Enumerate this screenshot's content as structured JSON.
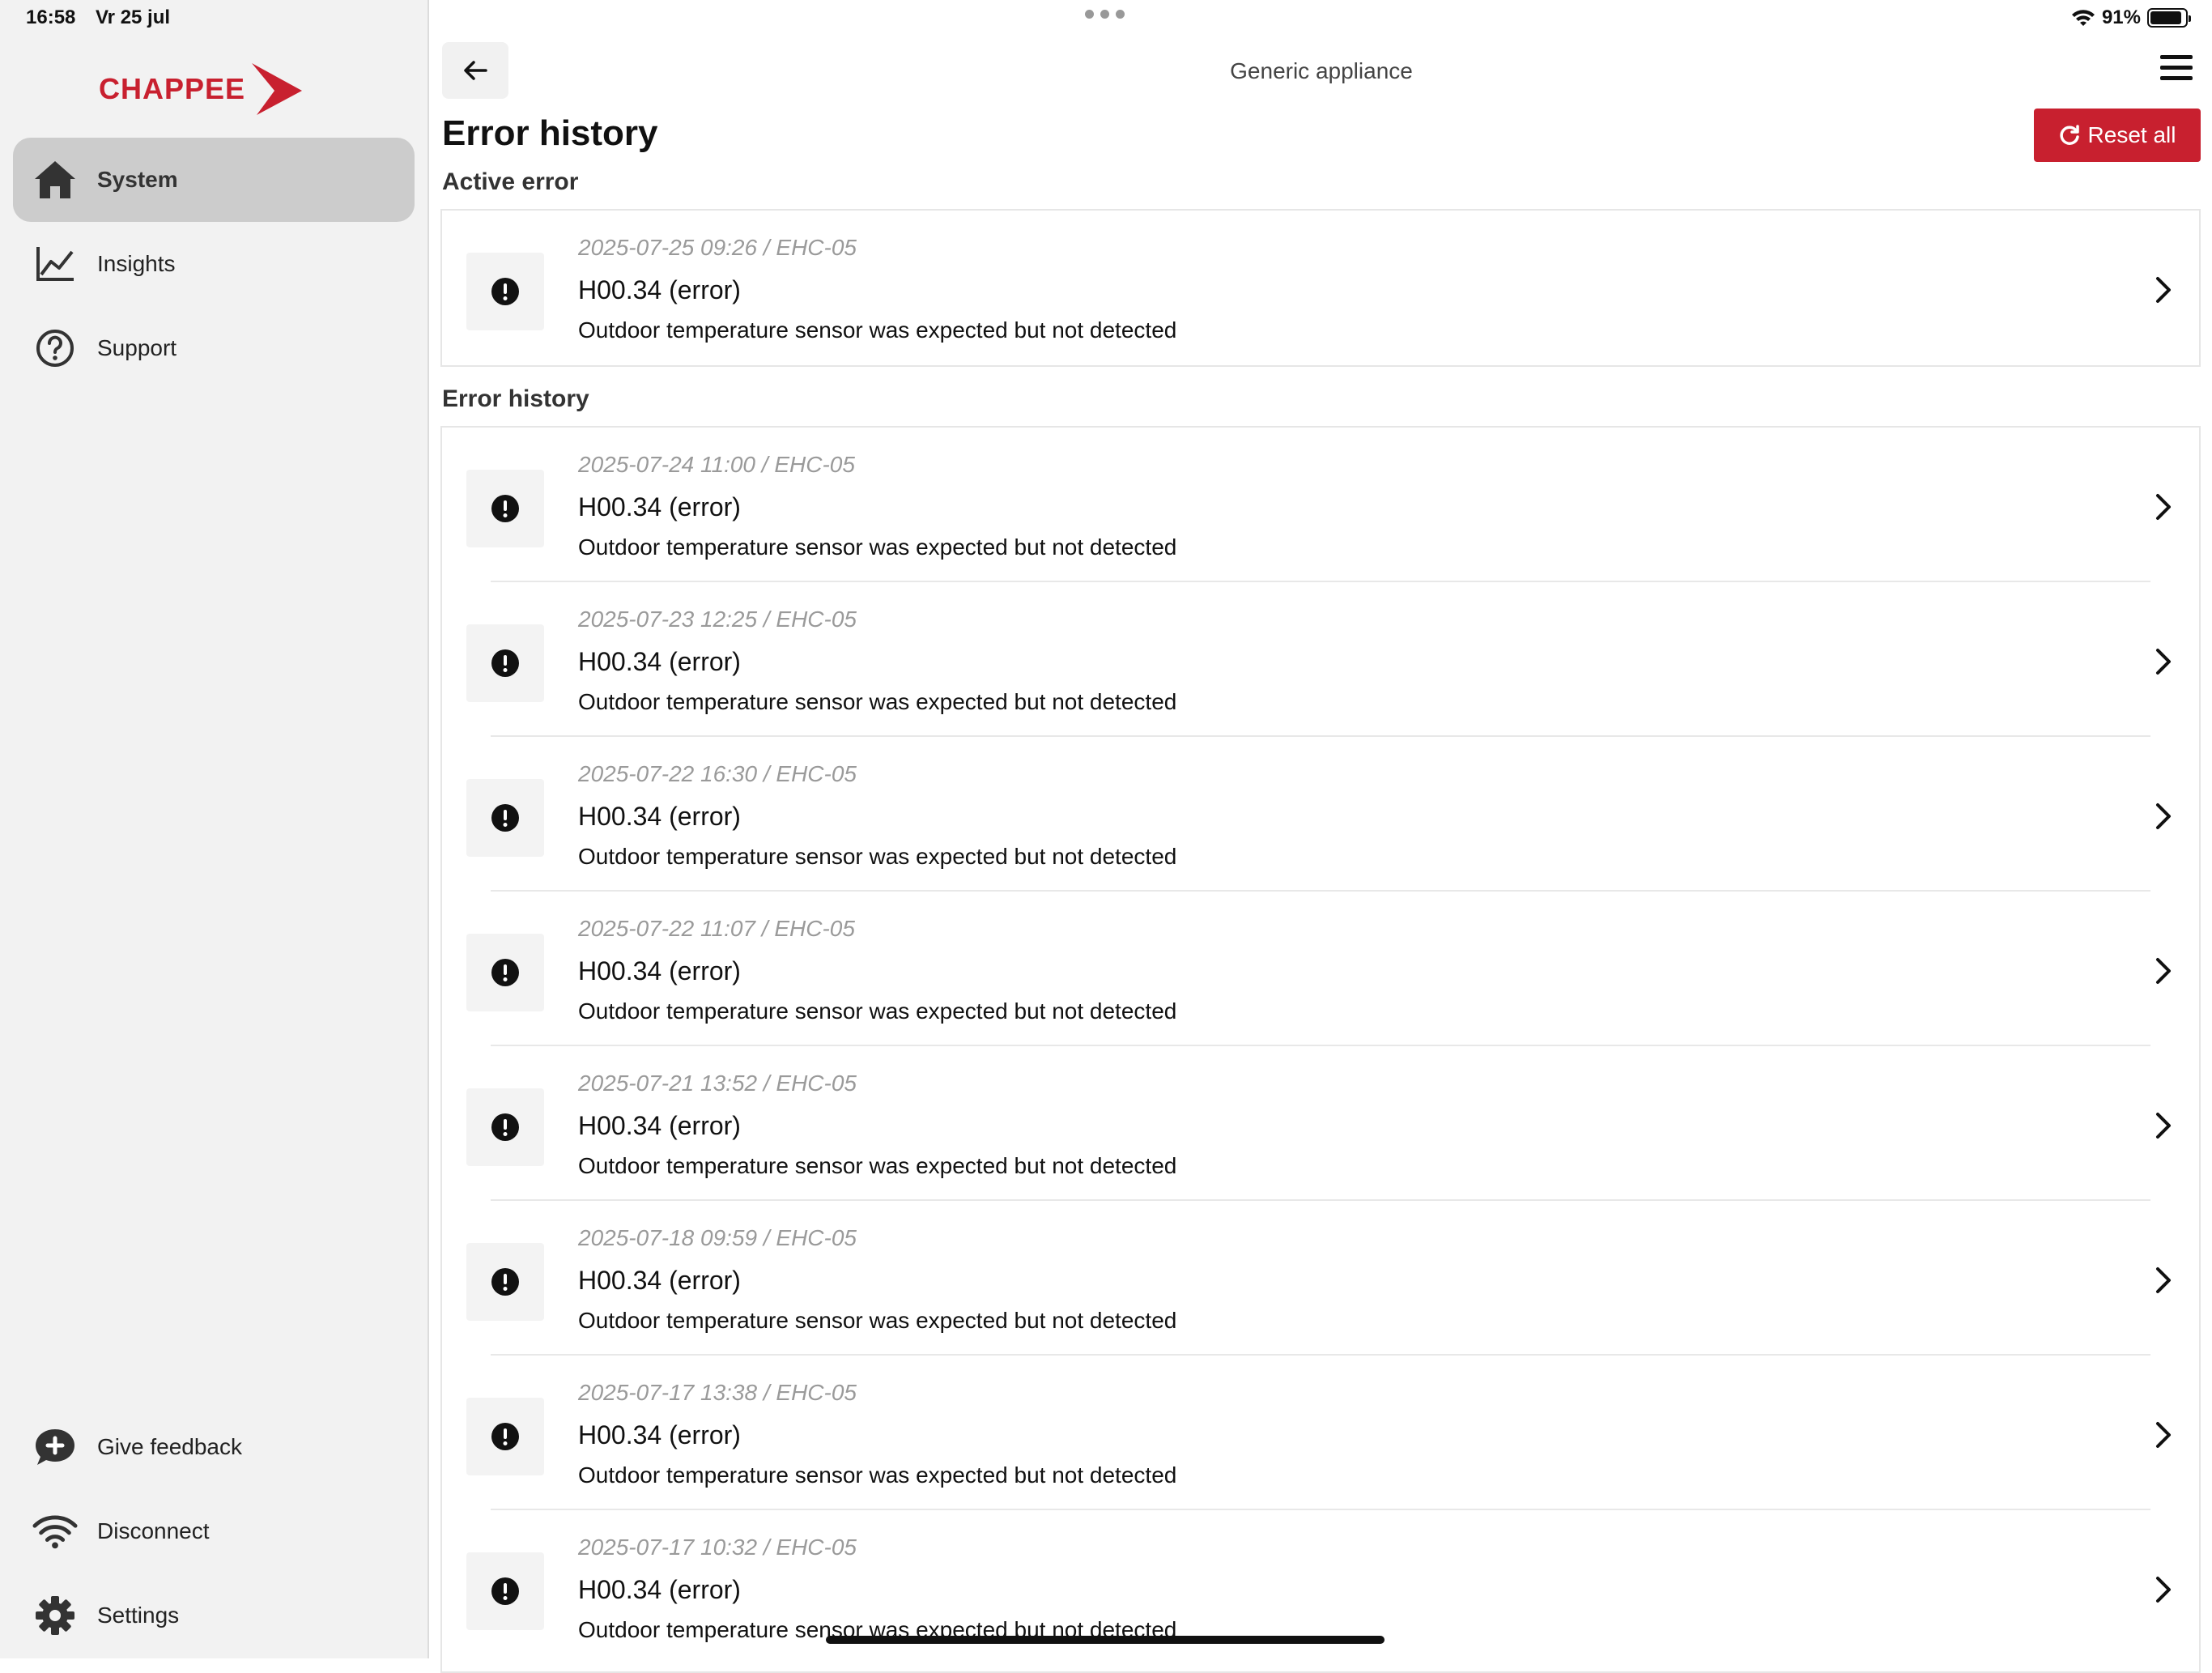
{
  "status": {
    "time": "16:58",
    "date": "Vr 25 jul",
    "battery": "91%",
    "battery_level": 0.91
  },
  "brand": {
    "name": "CHAPPEE",
    "color": "#c8202f"
  },
  "sidebar": {
    "top_items": [
      {
        "label": "System",
        "icon": "home-icon",
        "active": true
      },
      {
        "label": "Insights",
        "icon": "chart-line-icon",
        "active": false
      },
      {
        "label": "Support",
        "icon": "help-circle-icon",
        "active": false
      }
    ],
    "bottom_items": [
      {
        "label": "Give feedback",
        "icon": "feedback-bubble-icon"
      },
      {
        "label": "Disconnect",
        "icon": "wifi-icon"
      },
      {
        "label": "Settings",
        "icon": "gear-icon"
      }
    ]
  },
  "header": {
    "title": "Generic appliance",
    "back_icon": "arrow-left-icon",
    "menu_icon": "hamburger-menu-icon"
  },
  "page": {
    "title": "Error history",
    "reset_label": "Reset all",
    "reset_icon": "refresh-icon"
  },
  "active_section": {
    "title": "Active error",
    "items": [
      {
        "meta": "2025-07-25 09:26 / EHC-05",
        "code": "H00.34 (error)",
        "description": "Outdoor temperature sensor was expected but not detected"
      }
    ]
  },
  "history_section": {
    "title": "Error history",
    "items": [
      {
        "meta": "2025-07-24 11:00 / EHC-05",
        "code": "H00.34 (error)",
        "description": "Outdoor temperature sensor was expected but not detected"
      },
      {
        "meta": "2025-07-23 12:25 / EHC-05",
        "code": "H00.34 (error)",
        "description": "Outdoor temperature sensor was expected but not detected"
      },
      {
        "meta": "2025-07-22 16:30 / EHC-05",
        "code": "H00.34 (error)",
        "description": "Outdoor temperature sensor was expected but not detected"
      },
      {
        "meta": "2025-07-22 11:07 / EHC-05",
        "code": "H00.34 (error)",
        "description": "Outdoor temperature sensor was expected but not detected"
      },
      {
        "meta": "2025-07-21 13:52 / EHC-05",
        "code": "H00.34 (error)",
        "description": "Outdoor temperature sensor was expected but not detected"
      },
      {
        "meta": "2025-07-18 09:59 / EHC-05",
        "code": "H00.34 (error)",
        "description": "Outdoor temperature sensor was expected but not detected"
      },
      {
        "meta": "2025-07-17 13:38 / EHC-05",
        "code": "H00.34 (error)",
        "description": "Outdoor temperature sensor was expected but not detected"
      },
      {
        "meta": "2025-07-17 10:32 / EHC-05",
        "code": "H00.34 (error)",
        "description": "Outdoor temperature sensor was expected but not detected"
      }
    ]
  }
}
